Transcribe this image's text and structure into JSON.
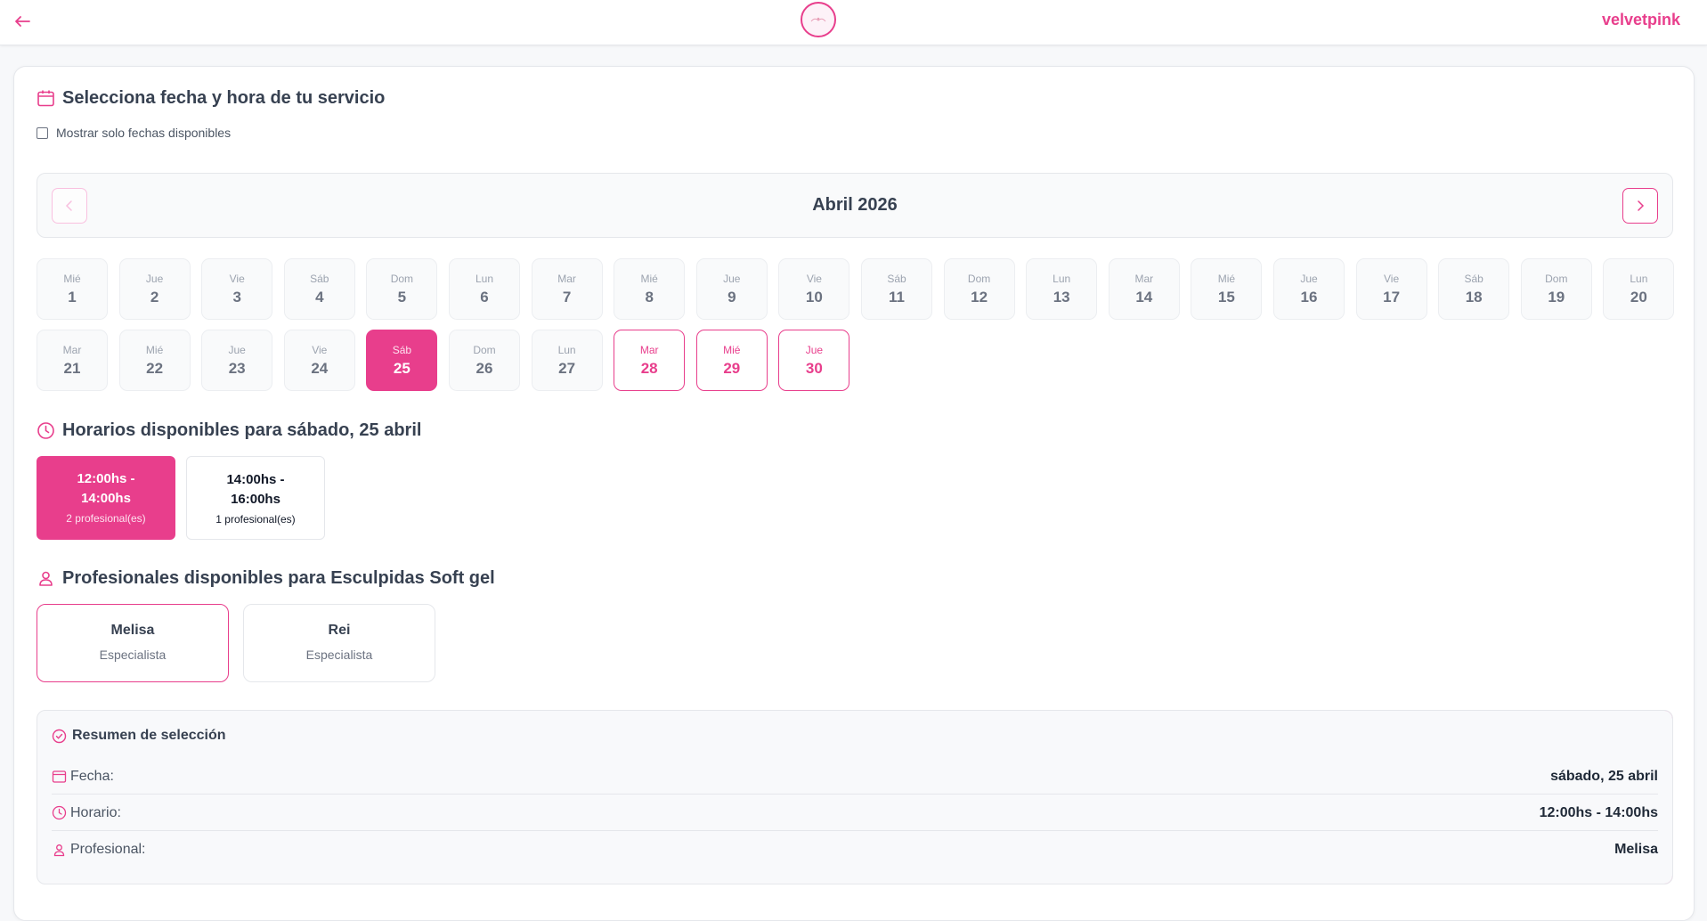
{
  "header": {
    "brand": "velvetpink",
    "colors": {
      "accent": "#e83e8c"
    }
  },
  "booking": {
    "title": "Selecciona fecha y hora de tu servicio",
    "filter_label": "Mostrar solo fechas disponibles",
    "filter_checked": false,
    "month_label": "Abril 2026",
    "days": [
      {
        "name": "Mié",
        "num": "1",
        "state": "disabled"
      },
      {
        "name": "Jue",
        "num": "2",
        "state": "disabled"
      },
      {
        "name": "Vie",
        "num": "3",
        "state": "disabled"
      },
      {
        "name": "Sáb",
        "num": "4",
        "state": "disabled"
      },
      {
        "name": "Dom",
        "num": "5",
        "state": "disabled"
      },
      {
        "name": "Lun",
        "num": "6",
        "state": "disabled"
      },
      {
        "name": "Mar",
        "num": "7",
        "state": "disabled"
      },
      {
        "name": "Mié",
        "num": "8",
        "state": "disabled"
      },
      {
        "name": "Jue",
        "num": "9",
        "state": "disabled"
      },
      {
        "name": "Vie",
        "num": "10",
        "state": "disabled"
      },
      {
        "name": "Sáb",
        "num": "11",
        "state": "disabled"
      },
      {
        "name": "Dom",
        "num": "12",
        "state": "disabled"
      },
      {
        "name": "Lun",
        "num": "13",
        "state": "disabled"
      },
      {
        "name": "Mar",
        "num": "14",
        "state": "disabled"
      },
      {
        "name": "Mié",
        "num": "15",
        "state": "disabled"
      },
      {
        "name": "Jue",
        "num": "16",
        "state": "disabled"
      },
      {
        "name": "Vie",
        "num": "17",
        "state": "disabled"
      },
      {
        "name": "Sáb",
        "num": "18",
        "state": "disabled"
      },
      {
        "name": "Dom",
        "num": "19",
        "state": "disabled"
      },
      {
        "name": "Lun",
        "num": "20",
        "state": "disabled"
      },
      {
        "name": "Mar",
        "num": "21",
        "state": "disabled"
      },
      {
        "name": "Mié",
        "num": "22",
        "state": "disabled"
      },
      {
        "name": "Jue",
        "num": "23",
        "state": "disabled"
      },
      {
        "name": "Vie",
        "num": "24",
        "state": "disabled"
      },
      {
        "name": "Sáb",
        "num": "25",
        "state": "selected"
      },
      {
        "name": "Dom",
        "num": "26",
        "state": "disabled"
      },
      {
        "name": "Lun",
        "num": "27",
        "state": "disabled"
      },
      {
        "name": "Mar",
        "num": "28",
        "state": "available"
      },
      {
        "name": "Mié",
        "num": "29",
        "state": "available"
      },
      {
        "name": "Jue",
        "num": "30",
        "state": "available"
      }
    ]
  },
  "schedules": {
    "title": "Horarios disponibles para sábado, 25 abril",
    "slots": [
      {
        "time": "12:00hs - 14:00hs",
        "pros": "2 profesional(es)",
        "selected": true
      },
      {
        "time": "14:00hs - 16:00hs",
        "pros": "1 profesional(es)",
        "selected": false
      }
    ]
  },
  "professionals": {
    "title": "Profesionales disponibles para Esculpidas Soft gel",
    "items": [
      {
        "name": "Melisa",
        "role": "Especialista",
        "selected": true
      },
      {
        "name": "Rei",
        "role": "Especialista",
        "selected": false
      }
    ]
  },
  "summary": {
    "title": "Resumen de selección",
    "date_label": "Fecha:",
    "date_value": "sábado, 25 abril",
    "time_label": "Horario:",
    "time_value": "12:00hs - 14:00hs",
    "pro_label": "Profesional:",
    "pro_value": "Melisa"
  }
}
